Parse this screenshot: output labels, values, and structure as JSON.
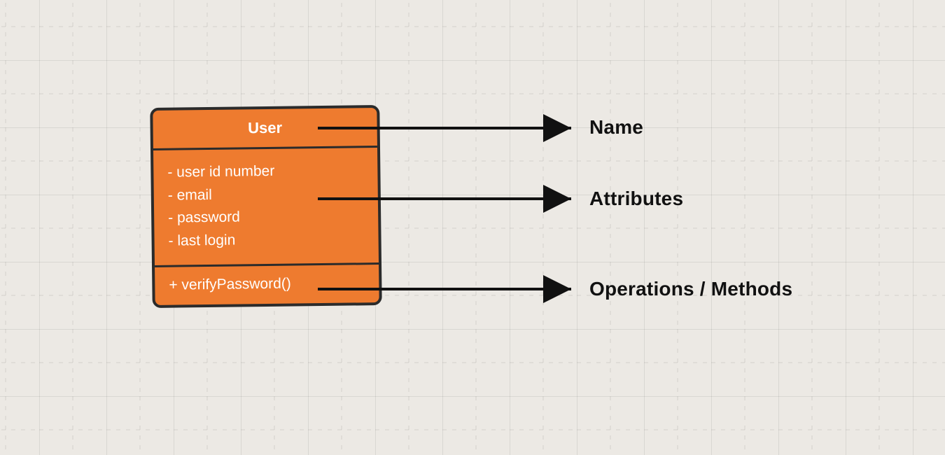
{
  "uml_class": {
    "name": "User",
    "attributes": [
      "- user id number",
      "- email",
      "- password",
      "- last login"
    ],
    "operations": [
      "+ verifyPassword()"
    ]
  },
  "labels": {
    "name": "Name",
    "attributes": "Attributes",
    "operations": "Operations / Methods"
  },
  "colors": {
    "class_fill": "#ee7b2f",
    "class_border": "#2b2b2b",
    "canvas_bg": "#ece9e4"
  }
}
